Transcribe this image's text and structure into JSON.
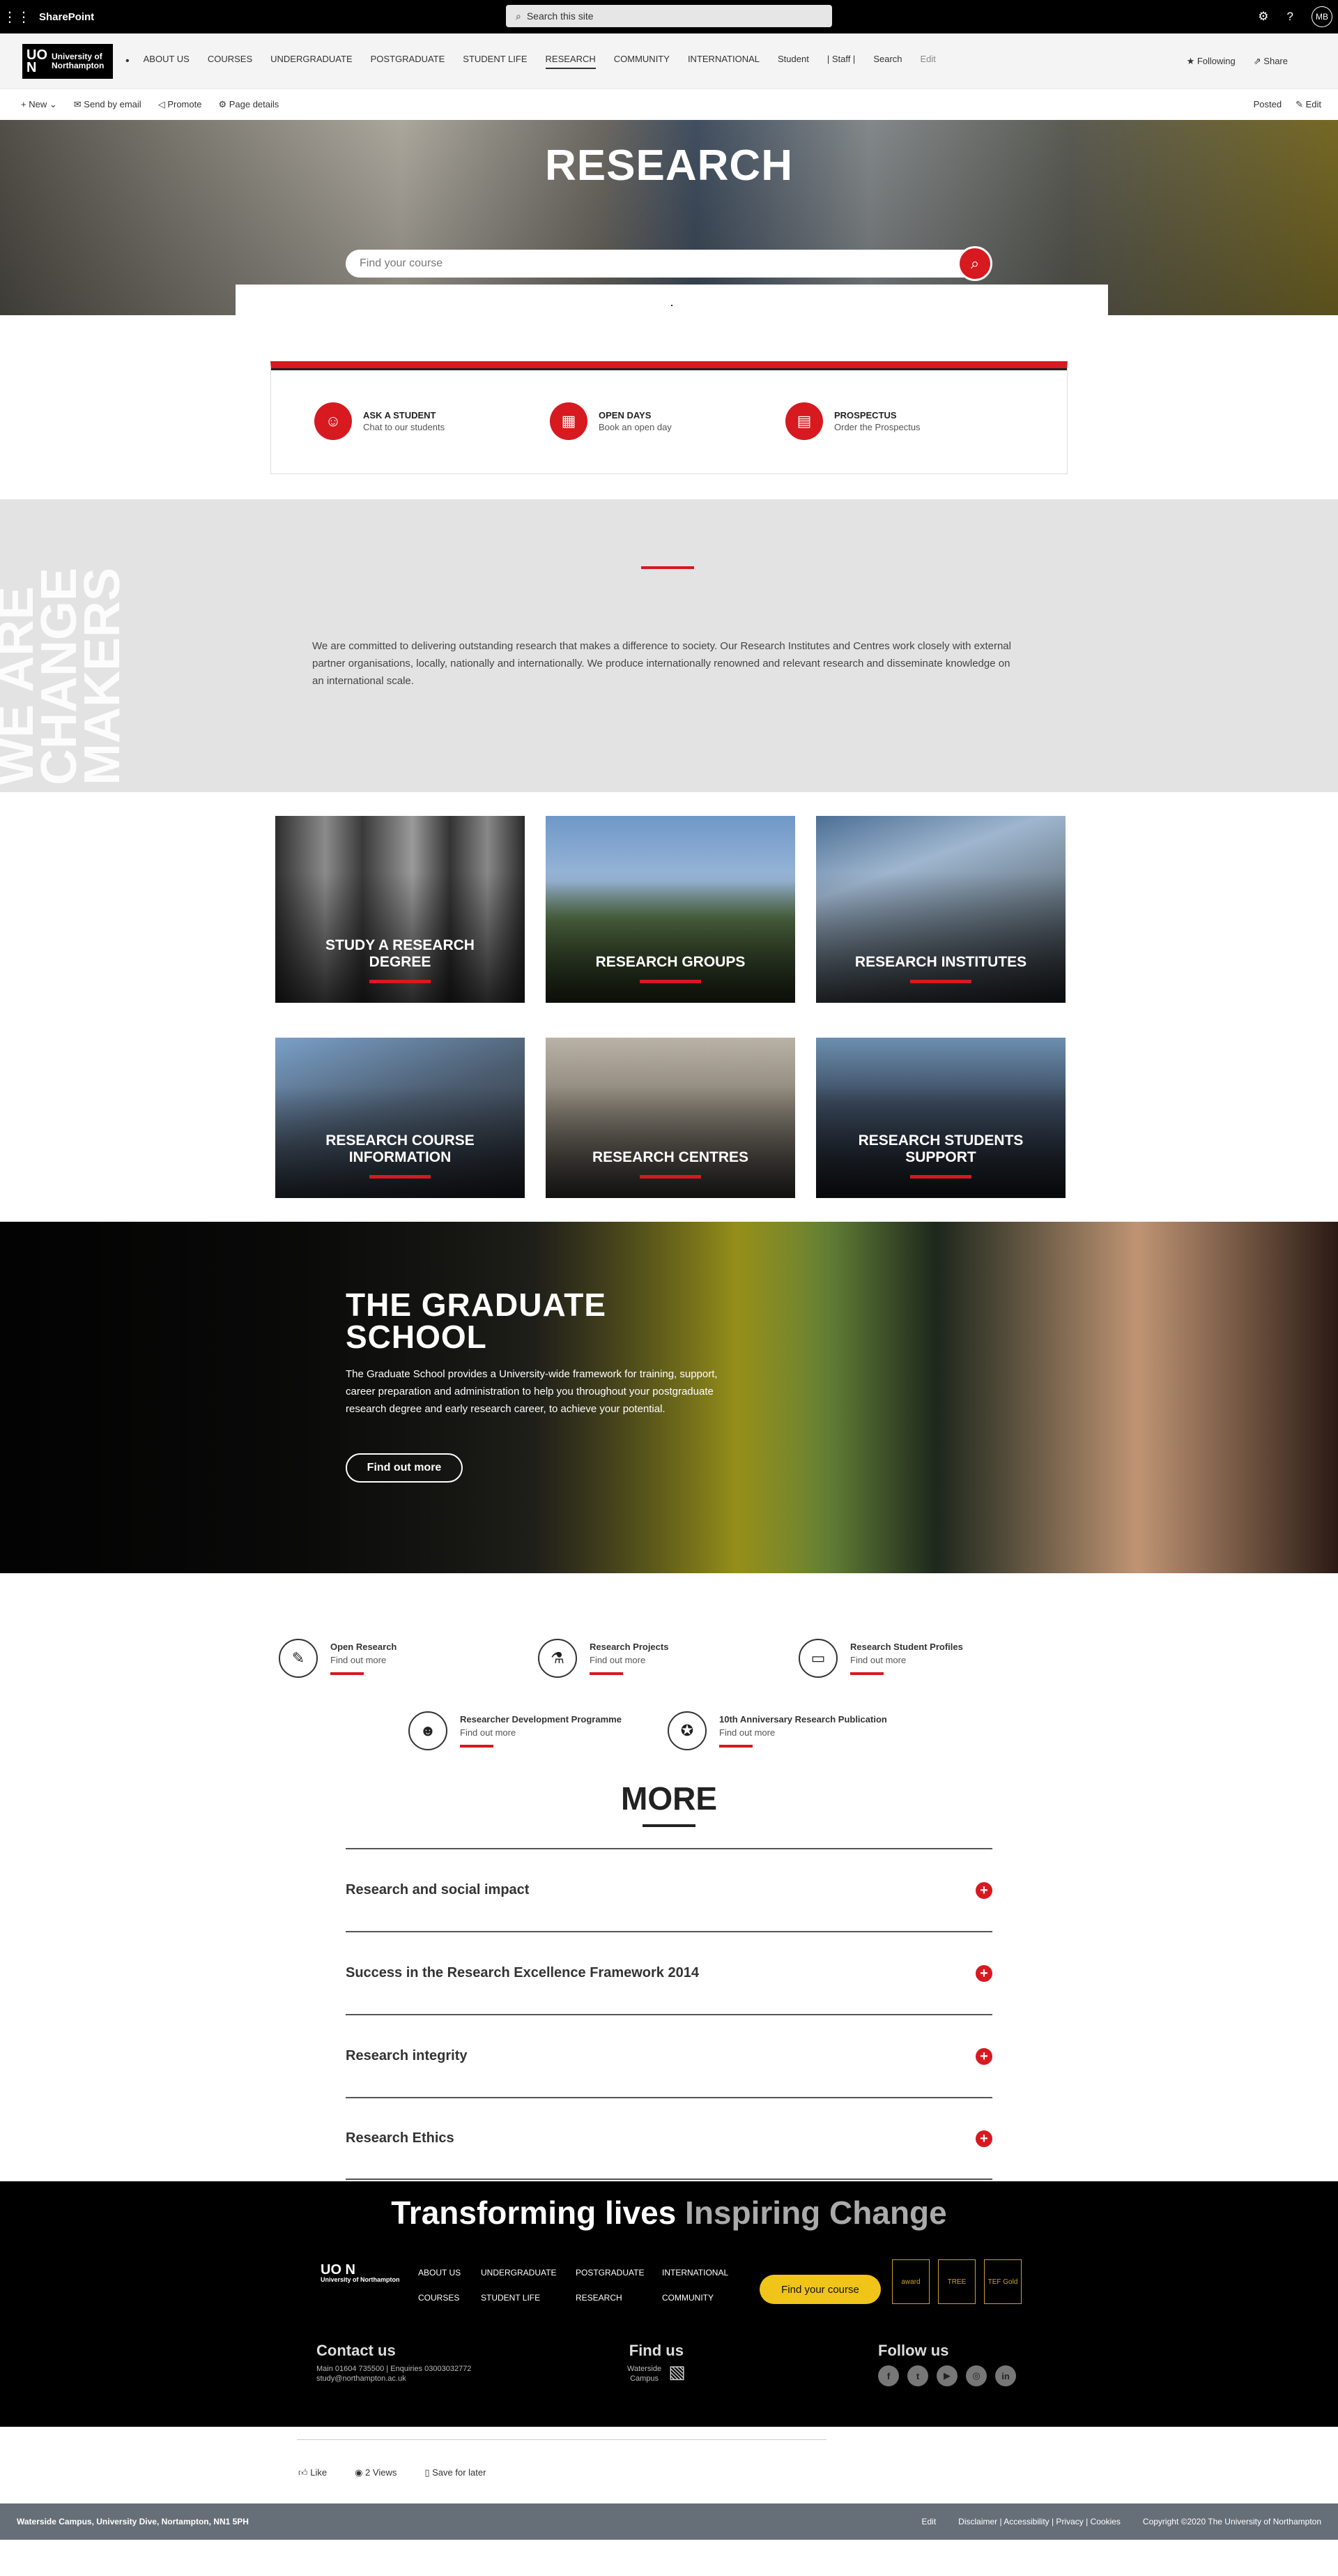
{
  "suite": {
    "app_name": "SharePoint",
    "search_placeholder": "Search this site",
    "user_initials": "MB"
  },
  "nav": {
    "logo_mark": "UO N",
    "logo_text": "University of Northampton",
    "items": [
      "ABOUT US",
      "COURSES",
      "UNDERGRADUATE",
      "POSTGRADUATE",
      "STUDENT LIFE",
      "RESEARCH",
      "COMMUNITY",
      "INTERNATIONAL",
      "Student",
      "| Staff |",
      "Search",
      "Edit"
    ],
    "following": "Following",
    "share": "Share"
  },
  "commandbar": {
    "new": "New",
    "send_by_email": "Send by email",
    "promote": "Promote",
    "page_details": "Page details",
    "posted": "Posted",
    "edit": "Edit"
  },
  "hero": {
    "title": "RESEARCH",
    "search_placeholder": "Find your course",
    "dot": "."
  },
  "quicklinks": [
    {
      "title": "ASK A STUDENT",
      "sub": "Chat to our students",
      "icon": "chat-person-icon"
    },
    {
      "title": "OPEN DAYS",
      "sub": "Book an open day",
      "icon": "calendar-icon"
    },
    {
      "title": "PROSPECTUS",
      "sub": "Order the Prospectus",
      "icon": "document-icon"
    }
  ],
  "intro": {
    "text": "We are committed to delivering outstanding research that makes a difference to society. Our Research Institutes and Centres work closely with external partner organisations, locally, nationally and internationally. We produce internationally renowned and relevant research and disseminate knowledge on an international scale.",
    "watermark_lines": [
      "WE ARE",
      "CHANGE",
      "MAKERS"
    ]
  },
  "tiles": [
    {
      "label": "STUDY A RESEARCH DEGREE"
    },
    {
      "label": "RESEARCH GROUPS"
    },
    {
      "label": "RESEARCH INSTITUTES"
    },
    {
      "label": "RESEARCH COURSE INFORMATION"
    },
    {
      "label": "RESEARCH CENTRES"
    },
    {
      "label": "RESEARCH STUDENTS SUPPORT"
    }
  ],
  "graduate": {
    "title_line1": "THE GRADUATE",
    "title_line2": "SCHOOL",
    "text": "The Graduate School provides a University-wide framework for training, support, career preparation and administration to help you throughout your postgraduate research degree and early research career, to achieve your potential.",
    "button": "Find out more"
  },
  "resource_links": [
    {
      "title": "Open Research",
      "sub": "Find out more",
      "icon": "open-research-icon"
    },
    {
      "title": "Research Projects",
      "sub": "Find out more",
      "icon": "microscope-icon"
    },
    {
      "title": "Research Student Profiles",
      "sub": "Find out more",
      "icon": "profile-card-icon"
    },
    {
      "title": "Researcher Development Programme",
      "sub": "Find out more",
      "icon": "people-group-icon"
    },
    {
      "title": "10th Anniversary Research Publication",
      "sub": "Find out more",
      "icon": "anniversary-icon"
    }
  ],
  "more": {
    "title": "MORE",
    "items": [
      "Research and social impact",
      "Success in the Research Excellence Framework 2014",
      "Research integrity",
      "Research Ethics"
    ]
  },
  "footer": {
    "tagline_bold": "Transforming lives",
    "tagline_grey": "Inspiring Change",
    "logo_mark": "UO N",
    "logo_text": "University of Northampton",
    "nav": [
      "ABOUT US",
      "UNDERGRADUATE",
      "POSTGRADUATE",
      "INTERNATIONAL",
      "COURSES",
      "STUDENT LIFE",
      "RESEARCH",
      "COMMUNITY"
    ],
    "find_course": "Find your course",
    "badges": [
      "award",
      "TREE",
      "TEF Gold"
    ],
    "contact_title": "Contact us",
    "contact_line1": "Main 01604 735500 | Enquiries 03003032772",
    "contact_line2": "study@northampton.ac.uk",
    "find_title": "Find us",
    "find_sub1": "Waterside",
    "find_sub2": "Campus",
    "follow_title": "Follow us",
    "socials": [
      "f",
      "t",
      "▶",
      "◎",
      "in"
    ]
  },
  "social": {
    "like": "Like",
    "views": "2 Views",
    "save": "Save for later"
  },
  "bottom": {
    "address": "Waterside Campus, University Dive, Nortampton, NN1 5PH",
    "edit": "Edit",
    "links": "Disclaimer | Accessibility | Privacy | Cookies",
    "copyright": "Copyright ©2020 The University of Northampton"
  }
}
